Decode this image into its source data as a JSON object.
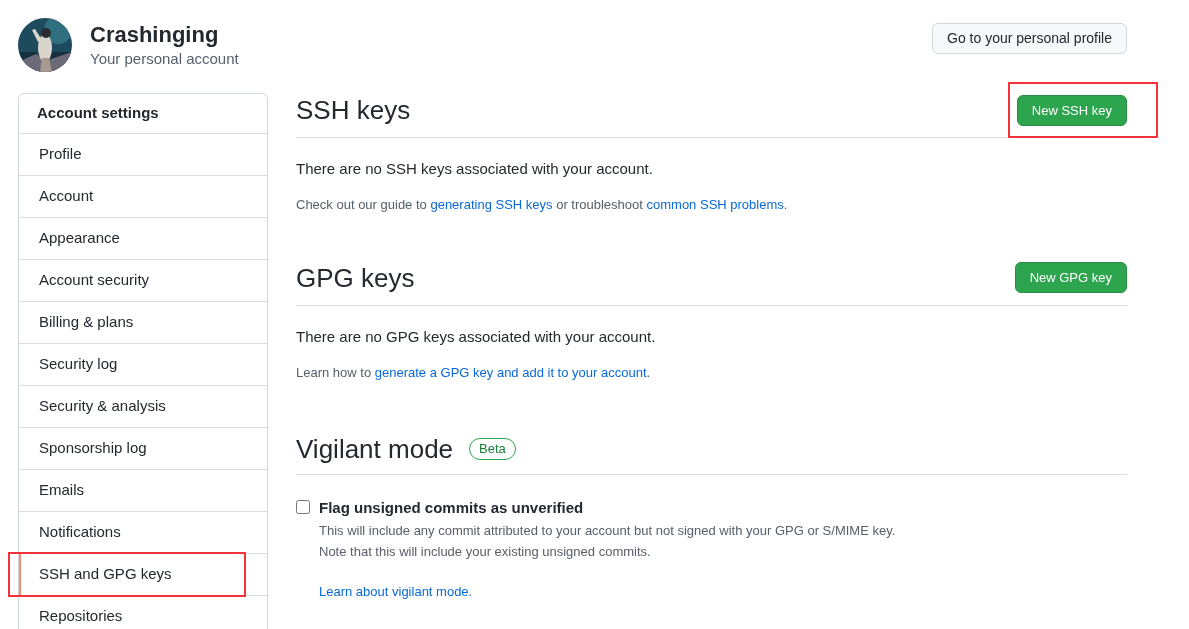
{
  "header": {
    "name": "Crashinging",
    "subtitle": "Your personal account",
    "profile_button": "Go to your personal profile"
  },
  "sidebar": {
    "title": "Account settings",
    "items": [
      {
        "label": "Profile",
        "selected": false,
        "annotated": false
      },
      {
        "label": "Account",
        "selected": false,
        "annotated": false
      },
      {
        "label": "Appearance",
        "selected": false,
        "annotated": false
      },
      {
        "label": "Account security",
        "selected": false,
        "annotated": false
      },
      {
        "label": "Billing & plans",
        "selected": false,
        "annotated": false
      },
      {
        "label": "Security log",
        "selected": false,
        "annotated": false
      },
      {
        "label": "Security & analysis",
        "selected": false,
        "annotated": false
      },
      {
        "label": "Sponsorship log",
        "selected": false,
        "annotated": false
      },
      {
        "label": "Emails",
        "selected": false,
        "annotated": false
      },
      {
        "label": "Notifications",
        "selected": false,
        "annotated": false
      },
      {
        "label": "SSH and GPG keys",
        "selected": true,
        "annotated": true
      },
      {
        "label": "Repositories",
        "selected": false,
        "annotated": false
      }
    ]
  },
  "sections": [
    {
      "title": "SSH keys",
      "button": {
        "label": "New SSH key",
        "annotated": true
      },
      "message": "There are no SSH keys associated with your account.",
      "note": [
        {
          "text": "Check out our guide to ",
          "link": false
        },
        {
          "text": "generating SSH keys",
          "link": true
        },
        {
          "text": " or troubleshoot ",
          "link": false
        },
        {
          "text": "common SSH problems",
          "link": true
        },
        {
          "text": ".",
          "link": false
        }
      ]
    },
    {
      "title": "GPG keys",
      "button": {
        "label": "New GPG key",
        "annotated": false
      },
      "message": "There are no GPG keys associated with your account.",
      "note": [
        {
          "text": "Learn how to ",
          "link": false
        },
        {
          "text": "generate a GPG key and add it to your account",
          "link": true
        },
        {
          "text": ".",
          "link": false
        }
      ]
    }
  ],
  "vigilant": {
    "title": "Vigilant mode",
    "badge": "Beta",
    "option": {
      "label": "Flag unsigned commits as unverified",
      "checked": false,
      "description": [
        "This will include any commit attributed to your account but not signed with your GPG or S/MIME key.",
        "Note that this will include your existing unsigned commits."
      ]
    },
    "learn": [
      {
        "text": "Learn about vigilant mode",
        "link": true
      },
      {
        "text": ".",
        "link": false
      }
    ]
  }
}
